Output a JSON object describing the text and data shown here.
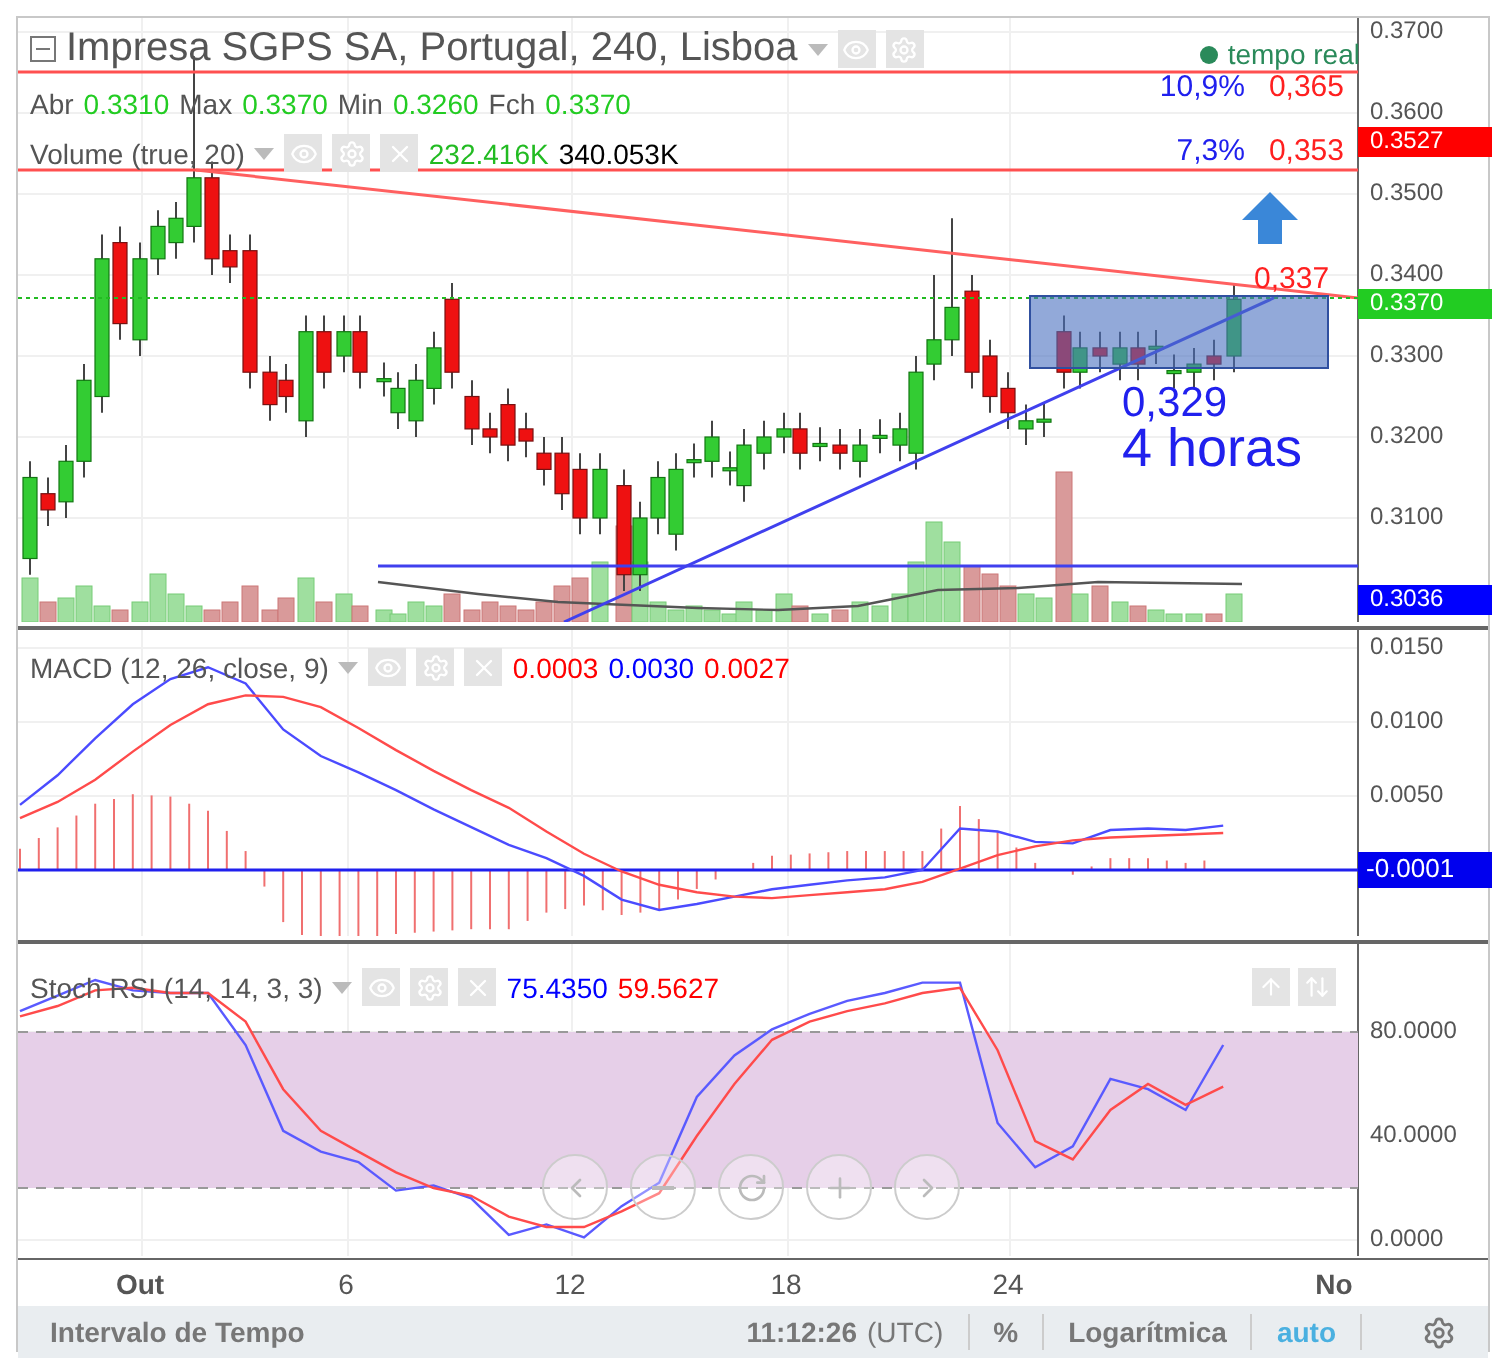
{
  "header": {
    "title": "Impresa SGPS SA, Portugal, 240, Lisboa",
    "status": "tempo real"
  },
  "ohlc": [
    {
      "label": "Abr",
      "value": "0.3310"
    },
    {
      "label": "Max",
      "value": "0.3370"
    },
    {
      "label": "Min",
      "value": "0.3260"
    },
    {
      "label": "Fch",
      "value": "0.3370"
    }
  ],
  "volume": {
    "label": "Volume (true, 20)",
    "values": [
      {
        "text": "232.416K",
        "color": "#22bb22"
      },
      {
        "text": "340.053K",
        "color": "#000000"
      }
    ]
  },
  "annotations": [
    {
      "percent": "10,9%",
      "price": "0,365"
    },
    {
      "percent": "7,3%",
      "price": "0,353"
    }
  ],
  "chart_labels": [
    {
      "kind": "price",
      "text": "0,337"
    },
    {
      "kind": "price_large",
      "text": "0,329"
    },
    {
      "kind": "note",
      "text": "4 horas"
    }
  ],
  "price_axis": {
    "labels": [
      "0.3700",
      "0.3600",
      "0.3500",
      "0.3400",
      "0.3300",
      "0.3200",
      "0.3100"
    ],
    "tags": [
      {
        "text": "0.3527",
        "color": "#ff0000"
      },
      {
        "text": "0.3370",
        "color": "#22cc22"
      },
      {
        "text": "0.3036",
        "color": "#0000ff"
      }
    ]
  },
  "macd": {
    "legend": "MACD (12, 26, close, 9)",
    "values": [
      {
        "text": "0.0003",
        "color": "#ff0000"
      },
      {
        "text": "0.0030",
        "color": "#0000ff"
      },
      {
        "text": "0.0027",
        "color": "#ff0000"
      }
    ],
    "axis_labels": [
      "0.0150",
      "0.0100",
      "0.0050"
    ],
    "tag": "-0.0001"
  },
  "stoch": {
    "legend": "Stoch RSI (14, 14, 3, 3)",
    "values": [
      {
        "text": "75.4350",
        "color": "#0000ff"
      },
      {
        "text": "59.5627",
        "color": "#ff0000"
      }
    ],
    "axis_labels": [
      "80.0000",
      "40.0000",
      "0.0000"
    ]
  },
  "date_axis": [
    {
      "label": "Out",
      "bold": true
    },
    {
      "label": "6",
      "bold": false
    },
    {
      "label": "12",
      "bold": false
    },
    {
      "label": "18",
      "bold": false
    },
    {
      "label": "24",
      "bold": false
    },
    {
      "label": "No",
      "bold": true
    }
  ],
  "status_bar": {
    "interval": "Intervalo de Tempo",
    "time": "11:12:26",
    "timezone": "(UTC)",
    "percent": "%",
    "scale": "Logarítmica",
    "auto": "auto"
  }
}
